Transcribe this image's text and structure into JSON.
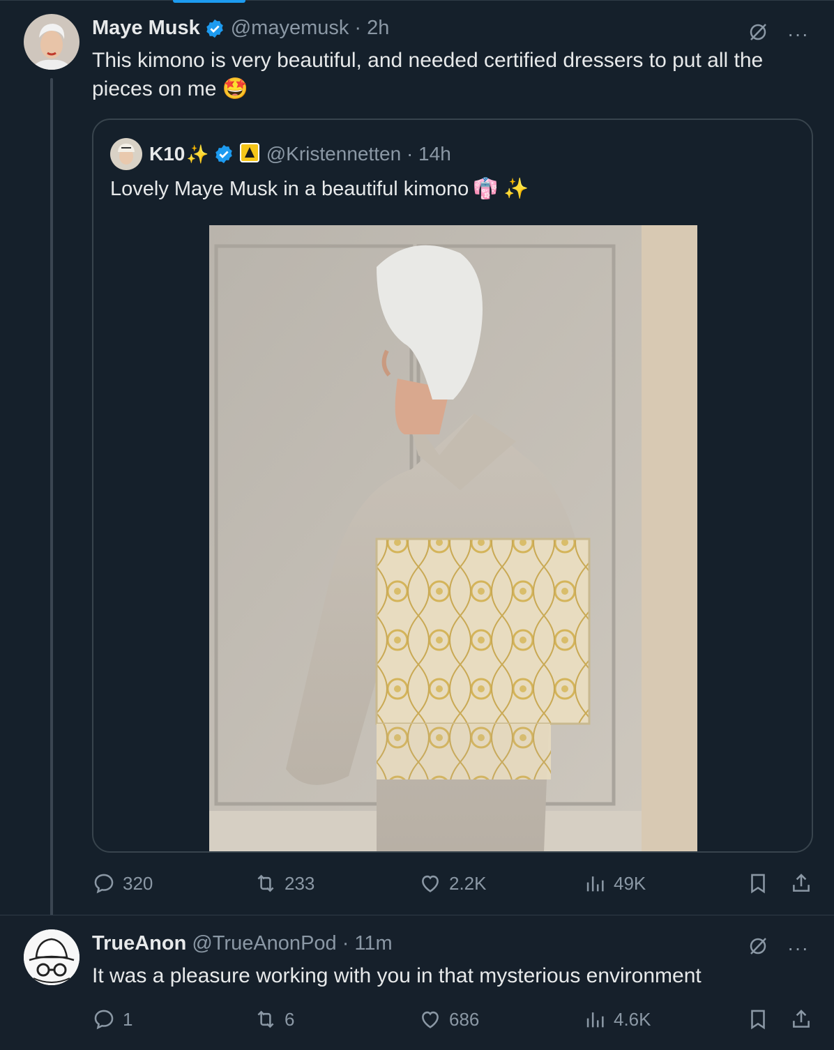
{
  "main_post": {
    "name": "Maye Musk",
    "handle_time": "@mayemusk · 2h",
    "text": "This kimono is very beautiful, and needed certified dressers to put all the pieces on me",
    "emoji": "🤩",
    "quoted": {
      "name": "K10",
      "name_emoji": "✨",
      "handle_time": "@Kristennetten · 14h",
      "text": "Lovely Maye Musk in a beautiful kimono",
      "text_emojis": "👘 ✨"
    },
    "stats": {
      "replies": "320",
      "reposts": "233",
      "likes": "2.2K",
      "views": "49K"
    }
  },
  "reply_post": {
    "name": "TrueAnon",
    "handle_time": "@TrueAnonPod · 11m",
    "text": "It was a pleasure working with you in that mysterious environment",
    "stats": {
      "replies": "1",
      "reposts": "6",
      "likes": "686",
      "views": "4.6K"
    }
  },
  "icons": {
    "verified": "verified-badge-icon",
    "grok": "grok-icon",
    "more": "more-options-icon",
    "reply": "reply-icon",
    "repost": "repost-icon",
    "like": "like-icon",
    "views": "views-icon",
    "bookmark": "bookmark-icon",
    "share": "share-icon"
  },
  "colors": {
    "background": "#15202b",
    "accent": "#1d9bf0",
    "muted": "#8b98a5",
    "text": "#e7e9ea",
    "border": "#38444d"
  }
}
